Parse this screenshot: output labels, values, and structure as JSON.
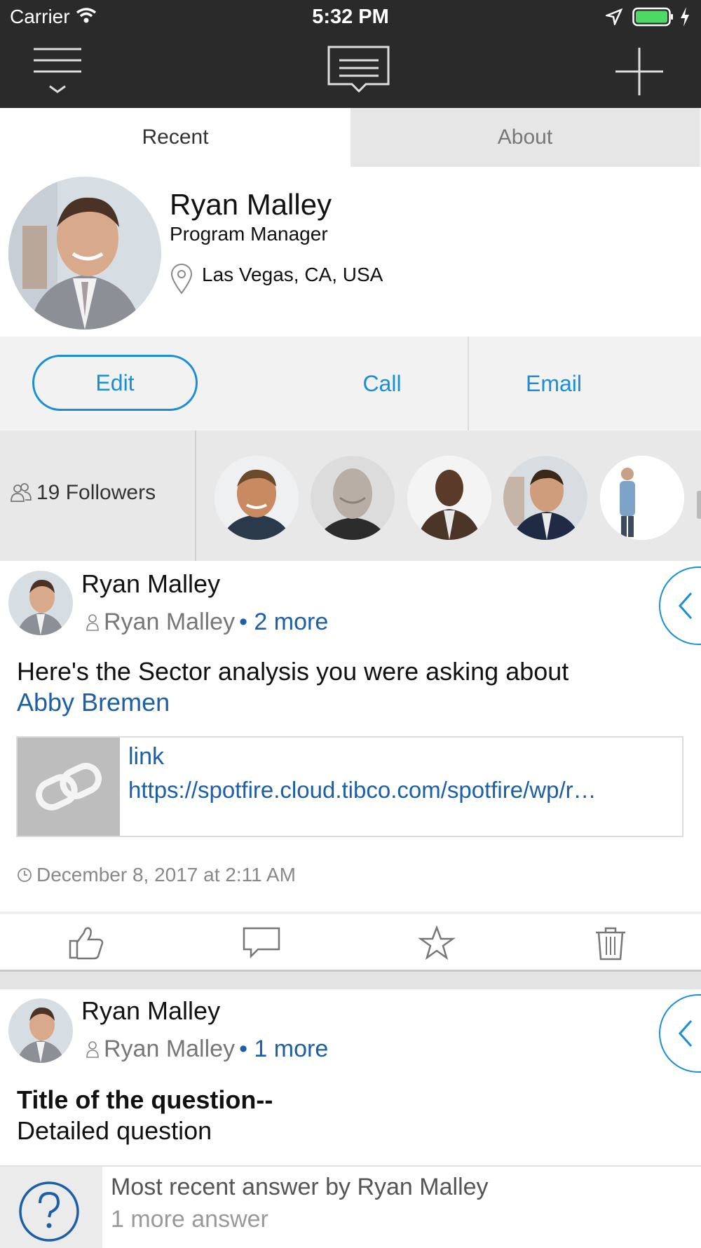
{
  "status_bar": {
    "carrier": "Carrier",
    "time": "5:32 PM"
  },
  "tabs": [
    {
      "label": "Recent"
    },
    {
      "label": "About"
    }
  ],
  "profile": {
    "name": "Ryan Malley",
    "title": "Program Manager",
    "location": "Las Vegas, CA, USA"
  },
  "actions": {
    "edit": "Edit",
    "call": "Call",
    "email": "Email"
  },
  "followers": {
    "label": "19 Followers"
  },
  "posts": [
    {
      "author": "Ryan Malley",
      "recipient": "Ryan Malley",
      "more": "• 2 more",
      "text": "Here's the Sector analysis you were asking about",
      "mention": "Abby Bremen",
      "link": {
        "title": "link",
        "url": "https://spotfire.cloud.tibco.com/spotfire/wp/r…"
      },
      "timestamp": "December 8, 2017 at 2:11 AM"
    },
    {
      "author": "Ryan Malley",
      "recipient": "Ryan Malley",
      "more": "• 1 more",
      "question_title": "Title of the question--",
      "question_detail": "Detailed question",
      "answer_summary": "Most recent answer by Ryan Malley",
      "answer_count": "1 more answer"
    }
  ],
  "colors": {
    "accent": "#1a8fd6",
    "link": "#1a5fa8",
    "topbar": "#2a2a2a",
    "battery": "#4cd964"
  }
}
